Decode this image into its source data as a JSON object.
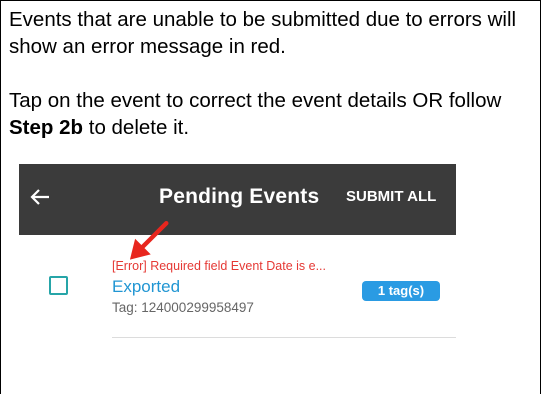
{
  "instructions": {
    "paragraph1": "Events that are unable to be submitted due to errors will show an error message in red.",
    "paragraph2_part1": "Tap on the event to correct the event details OR follow ",
    "paragraph2_bold": "Step 2b",
    "paragraph2_part2": " to delete it."
  },
  "app": {
    "back_icon": "arrow-left-icon",
    "title": "Pending Events",
    "submit_all_label": "SUBMIT ALL",
    "colors": {
      "appbar": "#3b3b3b",
      "error": "#e53935",
      "event_name": "#2196d3",
      "checkbox": "#26a5a8",
      "badge": "#2a9be3"
    }
  },
  "events": [
    {
      "error_message": "[Error] Required field Event Date is e...",
      "name": "Exported",
      "tag_line": "Tag: 124000299958497",
      "tag_badge": "1 tag(s)"
    }
  ],
  "annotation": {
    "arrow_icon": "red-arrow-icon",
    "color": "#e8261e"
  }
}
